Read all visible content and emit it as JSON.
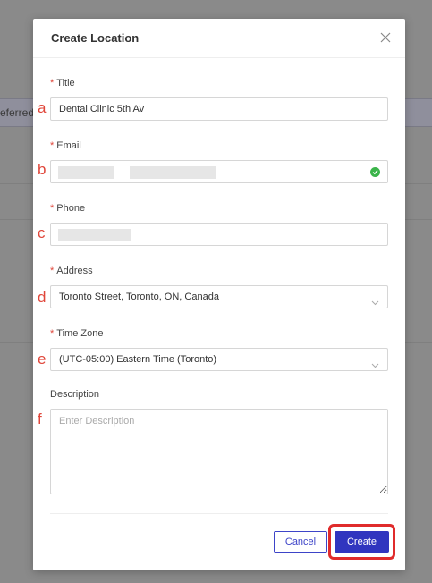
{
  "background": {
    "field_text": "eferred"
  },
  "modal": {
    "title": "Create Location",
    "close_icon": "close-icon"
  },
  "fields": {
    "title": {
      "label": "Title",
      "required": "*",
      "value": "Dental Clinic 5th Av"
    },
    "email": {
      "label": "Email",
      "required": "*",
      "value": "",
      "status_icon": "check-circle-icon"
    },
    "phone": {
      "label": "Phone",
      "required": "*",
      "value": ""
    },
    "address": {
      "label": "Address",
      "required": "*",
      "value": "Toronto Street, Toronto, ON, Canada"
    },
    "timezone": {
      "label": "Time Zone",
      "required": "*",
      "value": "(UTC-05:00) Eastern Time (Toronto)"
    },
    "description": {
      "label": "Description",
      "placeholder": "Enter Description",
      "value": ""
    }
  },
  "buttons": {
    "cancel": "Cancel",
    "create": "Create"
  },
  "markers": {
    "a": "a",
    "b": "b",
    "c": "c",
    "d": "d",
    "e": "e",
    "f": "f"
  },
  "colors": {
    "primary": "#3035bf",
    "required": "#e0463a",
    "success": "#3bb44a",
    "highlight": "#e02b2b"
  }
}
